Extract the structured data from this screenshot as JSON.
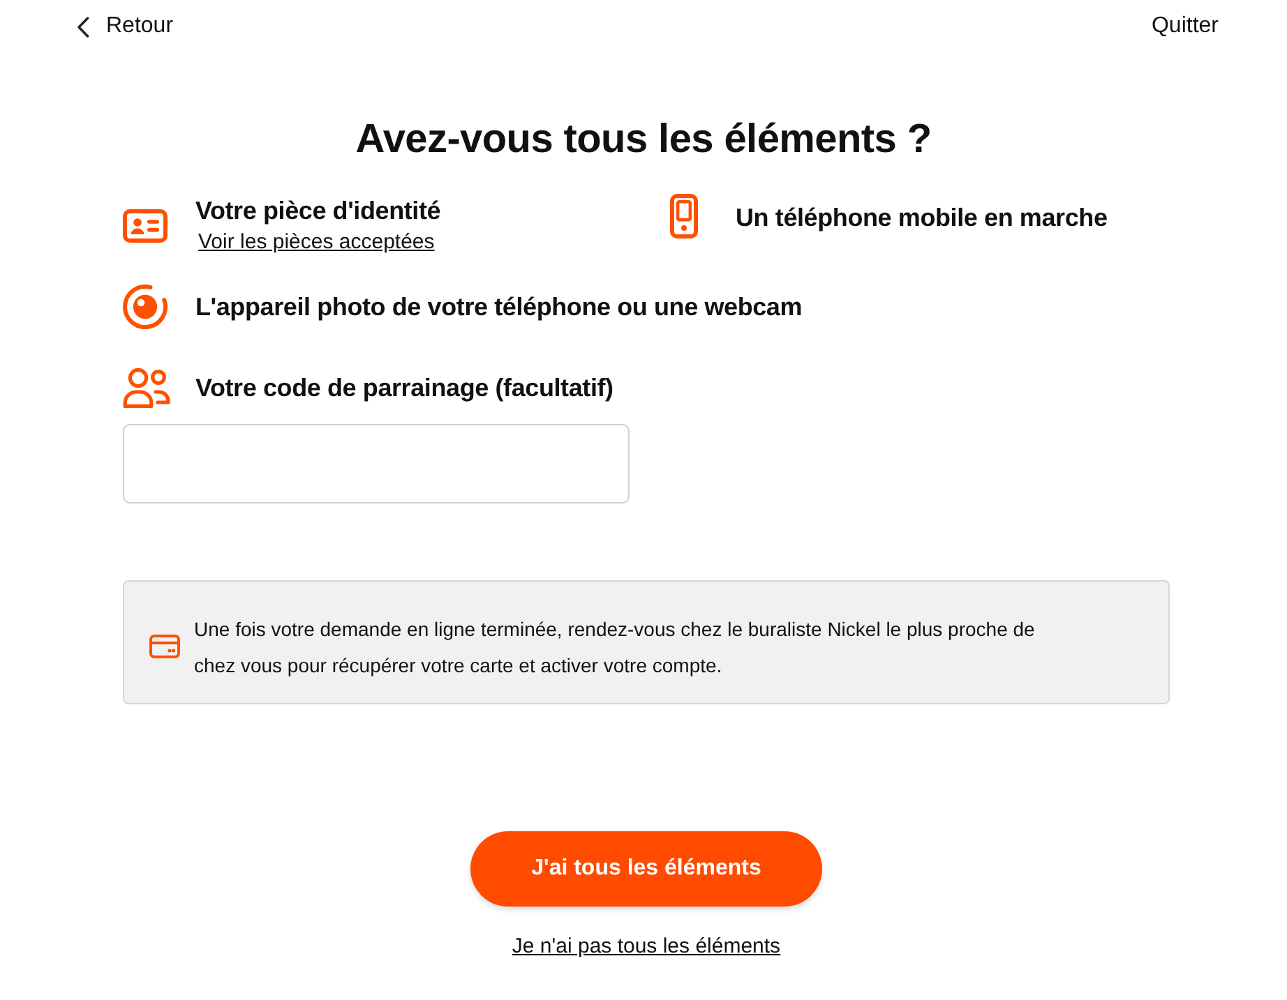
{
  "header": {
    "back": "Retour",
    "quit": "Quitter"
  },
  "title": "Avez-vous tous les éléments ?",
  "requirements": [
    {
      "kind": "id-card",
      "label": "Votre pièce d'identité",
      "link": "Voir les pièces acceptées"
    },
    {
      "kind": "phone",
      "label": "Un téléphone mobile en marche"
    },
    {
      "kind": "camera",
      "label": "L'appareil photo de votre téléphone ou une webcam"
    },
    {
      "kind": "people",
      "label": "Votre code de parrainage (facultatif)"
    }
  ],
  "info": {
    "text": "Une fois votre demande en ligne terminée, rendez-vous chez le buraliste Nickel le plus proche de chez vous pour récupérer votre carte et activer votre compte."
  },
  "actions": {
    "primary": "J'ai tous les éléments",
    "secondary": "Je n'ai pas tous les éléments"
  }
}
